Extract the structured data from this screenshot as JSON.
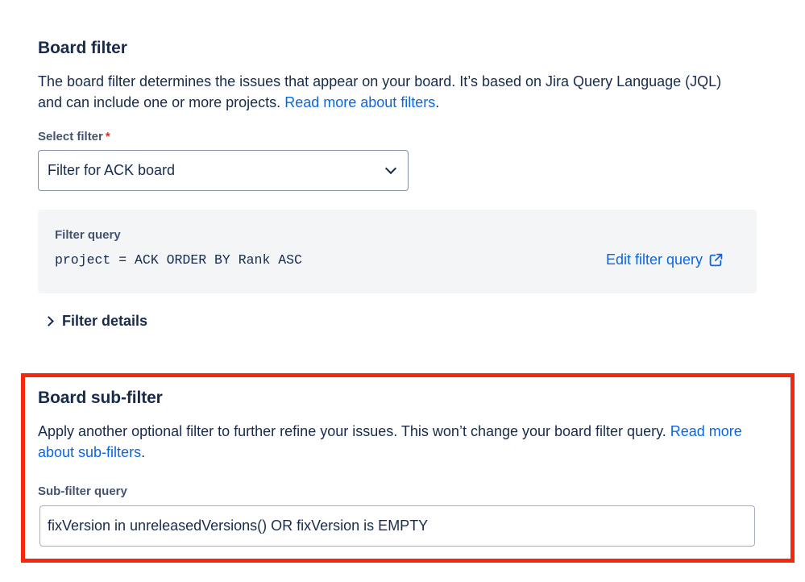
{
  "board_filter": {
    "title": "Board filter",
    "description": "The board filter determines the issues that appear on your board. It’s based on Jira Query Language (JQL) and can include one or more projects.",
    "read_more_link": "Read more about filters",
    "description_end": ".",
    "select_label": "Select filter",
    "required_marker": "*",
    "select_value": "Filter for ACK board",
    "query_label": "Filter query",
    "query": "project = ACK ORDER BY Rank ASC",
    "edit_link": "Edit filter query",
    "details_toggle": "Filter details"
  },
  "sub_filter": {
    "title": "Board sub-filter",
    "description": "Apply another optional filter to further refine your issues. This won’t change your board filter query.",
    "read_more_link": "Read more about sub-filters",
    "description_end": ".",
    "query_label": "Sub-filter query",
    "query_value": "fixVersion in unreleasedVersions() OR fixVersion is EMPTY"
  },
  "colors": {
    "link": "#0c66e4",
    "highlight": "#f4270f",
    "required": "#c9372c",
    "panel_bg": "#f4f5f7"
  },
  "icons": {
    "select_chevron": "chevron-down-icon",
    "edit_external": "external-link-icon",
    "details_chevron": "chevron-right-icon"
  }
}
